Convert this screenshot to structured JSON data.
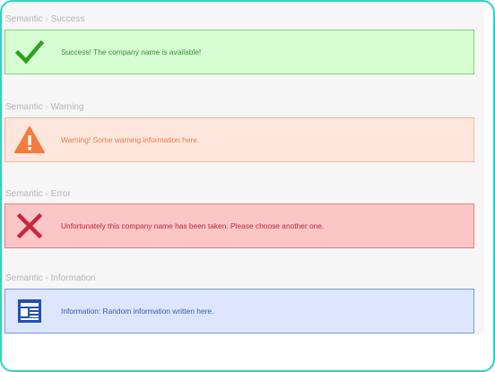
{
  "colors": {
    "frame_border": "#2bd6c0",
    "success_bg": "#d7fdd3",
    "success_text": "#2f9428",
    "warning_bg": "#fde6dc",
    "warning_text": "#ee7a45",
    "error_bg": "#fbc6c6",
    "error_text": "#b8283e",
    "info_bg": "#dde6fe",
    "info_text": "#2b5bb4"
  },
  "sections": {
    "success": {
      "label": "Semantic - Success",
      "icon": "checkmark-icon",
      "message": "Success! The company name is available!"
    },
    "warning": {
      "label": "Semantic - Warning",
      "icon": "warning-triangle-icon",
      "message": "Warning! Some warning information here."
    },
    "error": {
      "label": "Semantic - Error",
      "icon": "cross-icon",
      "message": "Unfortunately this company name has been taken.  Please choose another one."
    },
    "info": {
      "label": "Semantic - Information",
      "icon": "newspaper-icon",
      "message": "Information: Random information written here."
    }
  }
}
